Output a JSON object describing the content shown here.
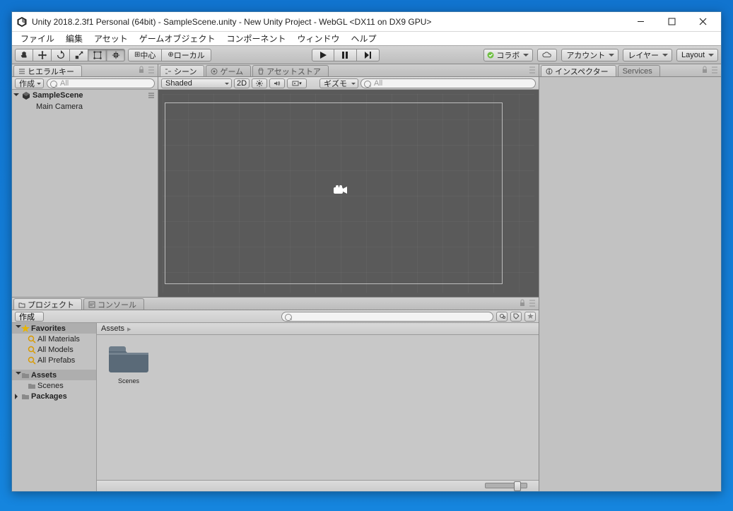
{
  "titlebar": {
    "title": "Unity 2018.2.3f1 Personal (64bit) - SampleScene.unity - New Unity Project - WebGL <DX11 on DX9 GPU>"
  },
  "menubar": [
    "ファイル",
    "編集",
    "アセット",
    "ゲームオブジェクト",
    "コンポーネント",
    "ウィンドウ",
    "ヘルプ"
  ],
  "toolbar": {
    "pivot": "中心",
    "space": "ローカル",
    "collab": "コラボ",
    "account": "アカウント",
    "layers": "レイヤー",
    "layout": "Layout"
  },
  "hierarchy": {
    "tab": "ヒエラルキー",
    "create": "作成",
    "searchPlaceholder": "All",
    "scene": "SampleScene",
    "items": [
      "Main Camera"
    ]
  },
  "sceneview": {
    "tabs": {
      "scene": "シーン",
      "game": "ゲーム",
      "assetstore": "アセットストア"
    },
    "shading": "Shaded",
    "mode2d": "2D",
    "gizmos": "ギズモ",
    "searchPlaceholder": "All"
  },
  "inspector": {
    "tabs": {
      "inspector": "インスペクター",
      "services": "Services"
    }
  },
  "project": {
    "tabs": {
      "project": "プロジェクト",
      "console": "コンソール"
    },
    "create": "作成",
    "favorites": "Favorites",
    "favItems": [
      "All Materials",
      "All Models",
      "All Prefabs"
    ],
    "assets": "Assets",
    "assetsChildren": [
      "Scenes"
    ],
    "packages": "Packages",
    "breadcrumb": "Assets",
    "gridItems": [
      {
        "label": "Scenes"
      }
    ]
  }
}
